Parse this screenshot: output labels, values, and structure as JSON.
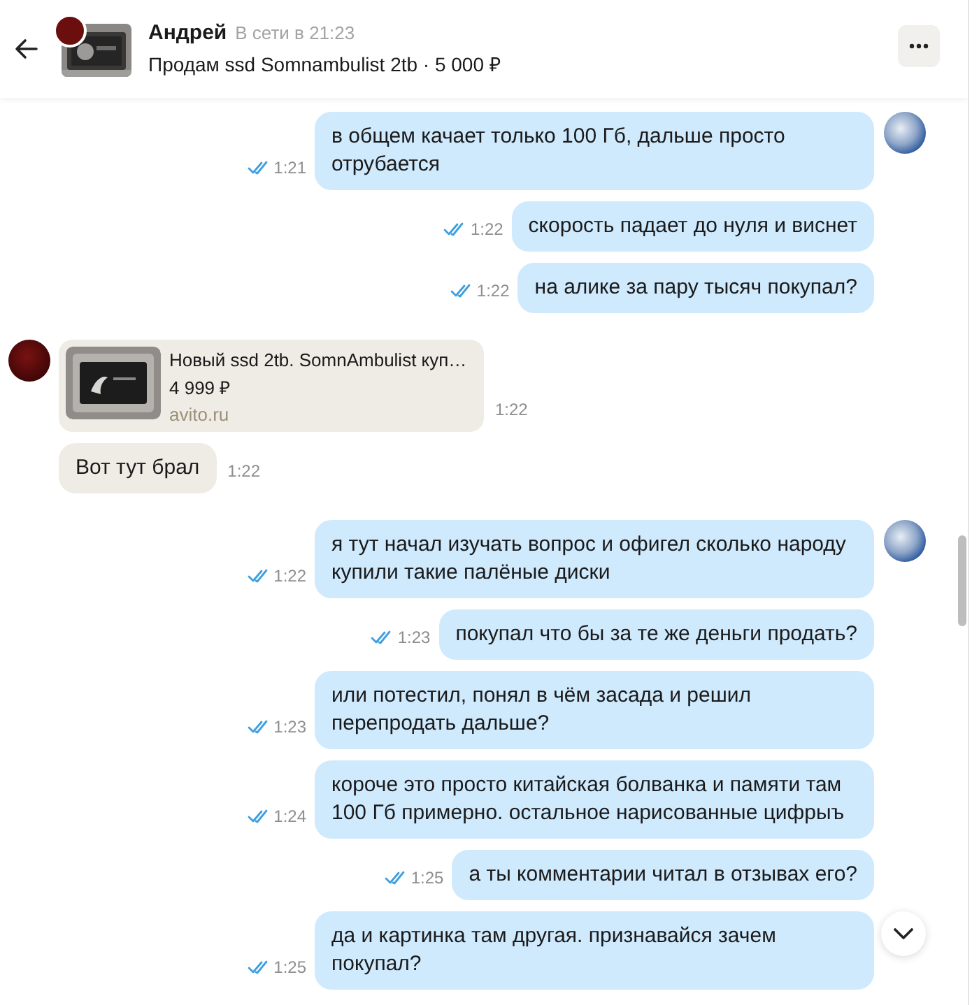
{
  "header": {
    "name": "Андрей",
    "status": "В сети в 21:23",
    "listing": "Продам ssd Somnambulist 2tb · 5 000 ₽"
  },
  "messages": [
    {
      "kind": "text",
      "outgoing": true,
      "avatar": true,
      "text": "в общем качает только 100 Гб, дальше просто отрубается",
      "time": "1:21",
      "read": true
    },
    {
      "kind": "text",
      "outgoing": true,
      "avatar": false,
      "text": "скорость падает до нуля и виснет",
      "time": "1:22",
      "read": true
    },
    {
      "kind": "text",
      "outgoing": true,
      "avatar": false,
      "text": "на алике за пару тысяч покупал?",
      "time": "1:22",
      "read": true
    },
    {
      "kind": "link",
      "outgoing": false,
      "avatar": true,
      "title": "Новый ssd 2tb. SomnAmbulist куп…",
      "price": "4 999 ₽",
      "domain": "avito.ru",
      "time": "1:22"
    },
    {
      "kind": "text",
      "outgoing": false,
      "avatar": false,
      "text": "Вот тут брал",
      "time": "1:22"
    },
    {
      "kind": "text",
      "outgoing": true,
      "avatar": true,
      "text": "я тут начал изучать вопрос и офигел сколько народу купили такие палёные диски",
      "time": "1:22",
      "read": true
    },
    {
      "kind": "text",
      "outgoing": true,
      "avatar": false,
      "text": "покупал что бы за те же деньги продать?",
      "time": "1:23",
      "read": true
    },
    {
      "kind": "text",
      "outgoing": true,
      "avatar": false,
      "text": "или потестил, понял в чём засада и решил перепродать дальше?",
      "time": "1:23",
      "read": true
    },
    {
      "kind": "text",
      "outgoing": true,
      "avatar": false,
      "text": "короче это просто китайская болванка и памяти там 100 Гб примерно. остальное нарисованные цифрыъ",
      "time": "1:24",
      "read": true
    },
    {
      "kind": "text",
      "outgoing": true,
      "avatar": false,
      "text": "а ты комментарии читал в отзывах его?",
      "time": "1:25",
      "read": true
    },
    {
      "kind": "text",
      "outgoing": true,
      "avatar": false,
      "text": "да и картинка там другая. признавайся зачем покупал?",
      "time": "1:25",
      "read": true
    }
  ]
}
